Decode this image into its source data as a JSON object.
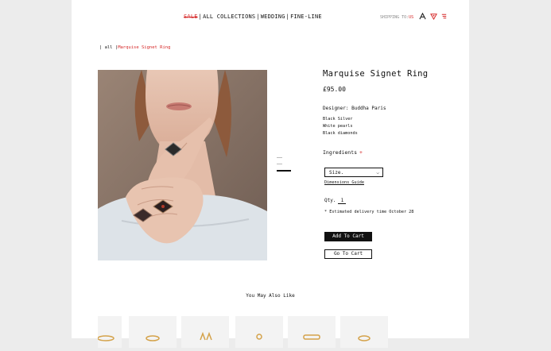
{
  "nav": {
    "items": [
      "SALE",
      "ALL COLLECTIONS",
      "WEDDING",
      "FINE-LINE"
    ],
    "separator": "|"
  },
  "header": {
    "shipping_label": "SHIPPING TO:",
    "shipping_country": "US",
    "icons": [
      "account-icon",
      "wishlist-icon",
      "menu-icon"
    ]
  },
  "breadcrumb": {
    "root": "all",
    "separator": "|",
    "current": "Marquise Signet Ring"
  },
  "product": {
    "title": "Marquise Signet Ring",
    "price": "£95.00",
    "designer": "Designer: Buddha Paris",
    "materials": [
      "Black Silver",
      "White pearls",
      "Black diamonds"
    ],
    "ingredients_label": "Ingredients",
    "ingredients_toggle": "+",
    "size_select": "Size.",
    "dimensions_link": "Dimensions Guide",
    "qty_label": "Qty.",
    "qty_value": "1",
    "delivery_note": "* Estimated delivery time October 28",
    "add_to_cart": "Add To Cart",
    "go_to_cart": "Go To Cart"
  },
  "gallery": {
    "thumb_count": 3,
    "active_index": 2
  },
  "recommendations": {
    "heading": "You May Also Like",
    "count": 6
  },
  "colors": {
    "accent": "#d62828",
    "text": "#111111",
    "background": "#ffffff",
    "page_bg": "#ececec"
  }
}
